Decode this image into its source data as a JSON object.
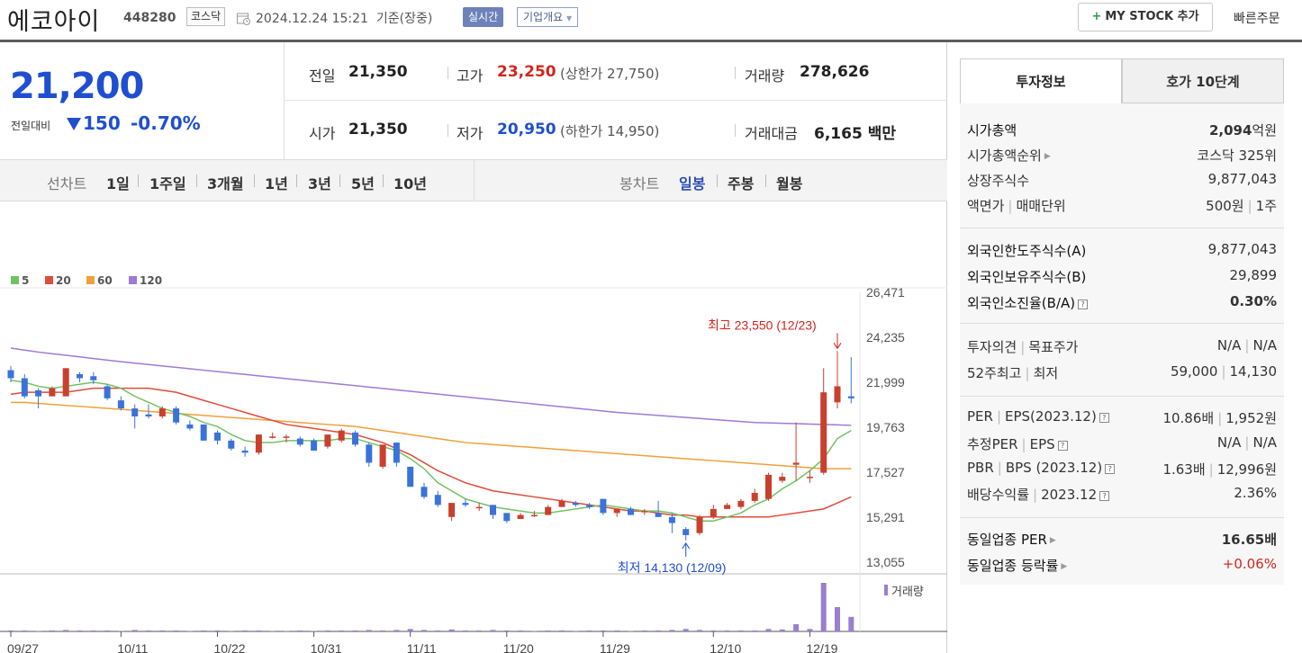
{
  "header": {
    "stock_name": "에코아이",
    "stock_code": "448280",
    "market": "코스닥",
    "datetime": "2024.12.24 15:21",
    "basis": "기준(장중)",
    "realtime_label": "실시간",
    "company_overview_label": "기업개요",
    "mystock_label": "MY STOCK 추가",
    "quick_order_label": "빠른주문"
  },
  "price": {
    "current": "21,200",
    "change_label": "전일대비",
    "change": "150",
    "change_pct": "-0.70%"
  },
  "stats": {
    "prev_close_label": "전일",
    "prev_close": "21,350",
    "high_label": "고가",
    "high": "23,250",
    "upper_limit_text": "(상한가 27,750)",
    "volume_label": "거래량",
    "volume": "278,626",
    "open_label": "시가",
    "open": "21,350",
    "low_label": "저가",
    "low": "20,950",
    "lower_limit_text": "(하한가 14,950)",
    "trade_value_label": "거래대금",
    "trade_value": "6,165",
    "trade_value_unit": "백만"
  },
  "toolbar": {
    "line_chart_label": "선차트",
    "periods": [
      "1일",
      "1주일",
      "3개월",
      "1년",
      "3년",
      "5년",
      "10년"
    ],
    "candle_chart_label": "봉차트",
    "candle_periods": [
      "일봉",
      "주봉",
      "월봉"
    ],
    "active_candle": "일봉"
  },
  "legend": [
    "5",
    "20",
    "60",
    "120"
  ],
  "colors": {
    "ma5": "#73c163",
    "ma20": "#e04c3b",
    "ma60": "#f0a03a",
    "ma120": "#a079d6",
    "up": "#c8402e",
    "down": "#3a73d8"
  },
  "annotations": {
    "high_text": "최고 23,550 (12/23)",
    "low_text": "최저 14,130 (12/09)"
  },
  "volume_label": "거래량",
  "chart_data": {
    "type": "candlestick",
    "y_ticks": [
      "26,471",
      "24,235",
      "21,999",
      "19,763",
      "17,527",
      "15,291",
      "13,055"
    ],
    "x_ticks": [
      "09/27",
      "10/11",
      "10/22",
      "10/31",
      "11/11",
      "11/20",
      "11/29",
      "12/10",
      "12/19"
    ],
    "ylim": [
      13055,
      26471
    ],
    "candles": [
      [
        22600,
        22200,
        22800,
        22000
      ],
      [
        22200,
        21300,
        22400,
        21200
      ],
      [
        21600,
        21300,
        21700,
        20700
      ],
      [
        21300,
        21700,
        21800,
        21300
      ],
      [
        21300,
        22700,
        22700,
        21300
      ],
      [
        22400,
        22200,
        22500,
        22000
      ],
      [
        22300,
        22100,
        22500,
        21900
      ],
      [
        21800,
        21200,
        21900,
        21100
      ],
      [
        21100,
        20700,
        21300,
        20600
      ],
      [
        20700,
        20300,
        20900,
        19700
      ],
      [
        20400,
        20300,
        20900,
        20200
      ],
      [
        20300,
        20700,
        20800,
        20200
      ],
      [
        20700,
        20000,
        20800,
        19900
      ],
      [
        19900,
        19700,
        20100,
        19600
      ],
      [
        19900,
        19100,
        19900,
        19100
      ],
      [
        19500,
        19100,
        19600,
        18900
      ],
      [
        19100,
        18700,
        19200,
        18600
      ],
      [
        18600,
        18500,
        18800,
        18300
      ],
      [
        18500,
        19400,
        19400,
        18400
      ],
      [
        19300,
        19300,
        19500,
        19200
      ],
      [
        19300,
        19300,
        19400,
        19000
      ],
      [
        19200,
        18900,
        19300,
        18800
      ],
      [
        19100,
        18600,
        19200,
        18600
      ],
      [
        18800,
        19400,
        19400,
        18700
      ],
      [
        19100,
        19600,
        19700,
        19000
      ],
      [
        19500,
        18900,
        19600,
        18800
      ],
      [
        18900,
        18000,
        19000,
        17800
      ],
      [
        17800,
        18900,
        18900,
        17700
      ],
      [
        19000,
        18000,
        19000,
        17800
      ],
      [
        17800,
        16800,
        17800,
        16800
      ],
      [
        16800,
        16300,
        17000,
        16200
      ],
      [
        16400,
        15900,
        16600,
        15800
      ],
      [
        15300,
        16000,
        16000,
        15100
      ],
      [
        16000,
        15900,
        16200,
        15800
      ],
      [
        15800,
        15800,
        16000,
        15600
      ],
      [
        15900,
        15400,
        15900,
        15200
      ],
      [
        15500,
        15100,
        15500,
        15000
      ],
      [
        15200,
        15400,
        15500,
        15200
      ],
      [
        15400,
        15400,
        15600,
        15300
      ],
      [
        15400,
        15800,
        15900,
        15400
      ],
      [
        15800,
        16100,
        16200,
        15800
      ],
      [
        16000,
        15900,
        16100,
        15800
      ],
      [
        15900,
        15800,
        16000,
        15700
      ],
      [
        16200,
        15500,
        16200,
        15400
      ],
      [
        15500,
        15700,
        15700,
        15300
      ],
      [
        15700,
        15400,
        15800,
        15400
      ],
      [
        15600,
        15600,
        15700,
        15400
      ],
      [
        15500,
        15300,
        16100,
        15300
      ],
      [
        15300,
        15000,
        15500,
        14500
      ],
      [
        14700,
        14400,
        14800,
        14130
      ],
      [
        14500,
        15300,
        15400,
        14400
      ],
      [
        15300,
        15700,
        15900,
        15200
      ],
      [
        15700,
        15900,
        16000,
        15700
      ],
      [
        15800,
        16100,
        16200,
        15700
      ],
      [
        16100,
        16500,
        16700,
        16000
      ],
      [
        16200,
        17400,
        17500,
        16100
      ],
      [
        17100,
        17300,
        17500,
        17000
      ],
      [
        17900,
        18000,
        20000,
        17100
      ],
      [
        17300,
        17300,
        17600,
        17000
      ],
      [
        17500,
        21500,
        22700,
        17400
      ],
      [
        21000,
        21800,
        23550,
        20700
      ],
      [
        21300,
        21200,
        23250,
        20950
      ]
    ],
    "ma5": [
      22100,
      22000,
      21800,
      21700,
      21800,
      21900,
      22000,
      21900,
      21700,
      21300,
      21000,
      20700,
      20500,
      20300,
      20000,
      19800,
      19400,
      19100,
      19000,
      19000,
      19100,
      19100,
      19100,
      19100,
      19200,
      19200,
      19000,
      18800,
      18600,
      18200,
      17700,
      17000,
      16600,
      16200,
      16000,
      15800,
      15700,
      15600,
      15500,
      15500,
      15600,
      15700,
      15800,
      15900,
      15800,
      15700,
      15600,
      15600,
      15500,
      15300,
      15100,
      15100,
      15300,
      15500,
      15900,
      16200,
      16700,
      17100,
      17600,
      18200,
      19200,
      19600
    ],
    "ma20": [
      21400,
      21500,
      21500,
      21500,
      21500,
      21600,
      21700,
      21700,
      21700,
      21700,
      21700,
      21600,
      21500,
      21300,
      21100,
      20900,
      20700,
      20500,
      20300,
      20100,
      19900,
      19800,
      19700,
      19600,
      19500,
      19400,
      19200,
      19000,
      18700,
      18400,
      18000,
      17600,
      17300,
      17000,
      16800,
      16600,
      16500,
      16400,
      16300,
      16200,
      16100,
      16000,
      15900,
      15800,
      15700,
      15600,
      15600,
      15500,
      15400,
      15400,
      15300,
      15300,
      15300,
      15300,
      15300,
      15300,
      15400,
      15500,
      15600,
      15700,
      16000,
      16300
    ],
    "ma60": [
      21000,
      21000,
      20950,
      20900,
      20850,
      20800,
      20750,
      20700,
      20650,
      20600,
      20550,
      20500,
      20450,
      20400,
      20350,
      20300,
      20250,
      20200,
      20150,
      20100,
      20050,
      20000,
      19950,
      19900,
      19850,
      19800,
      19700,
      19600,
      19500,
      19400,
      19300,
      19200,
      19100,
      19000,
      18950,
      18900,
      18850,
      18800,
      18750,
      18700,
      18650,
      18600,
      18550,
      18500,
      18450,
      18400,
      18350,
      18300,
      18250,
      18200,
      18150,
      18100,
      18050,
      18000,
      17950,
      17900,
      17850,
      17800,
      17750,
      17700,
      17700,
      17700
    ],
    "ma120": [
      23700,
      23600,
      23500,
      23420,
      23340,
      23260,
      23180,
      23100,
      23020,
      22950,
      22880,
      22810,
      22740,
      22670,
      22600,
      22530,
      22460,
      22390,
      22320,
      22250,
      22180,
      22110,
      22040,
      21970,
      21900,
      21830,
      21760,
      21690,
      21620,
      21550,
      21480,
      21410,
      21340,
      21270,
      21200,
      21130,
      21060,
      20990,
      20920,
      20850,
      20780,
      20710,
      20640,
      20570,
      20500,
      20450,
      20400,
      20350,
      20300,
      20250,
      20200,
      20150,
      20100,
      20050,
      20000,
      19980,
      19960,
      19940,
      19920,
      19900,
      19880,
      19860
    ],
    "volume_rel": [
      0.02,
      0.02,
      0.01,
      0.02,
      0.03,
      0.02,
      0.02,
      0.02,
      0.01,
      0.03,
      0.02,
      0.02,
      0.02,
      0.01,
      0.02,
      0.02,
      0.01,
      0.02,
      0.02,
      0.01,
      0.01,
      0.02,
      0.01,
      0.02,
      0.02,
      0.02,
      0.03,
      0.02,
      0.03,
      0.05,
      0.03,
      0.02,
      0.04,
      0.02,
      0.02,
      0.03,
      0.02,
      0.02,
      0.01,
      0.02,
      0.02,
      0.01,
      0.02,
      0.02,
      0.02,
      0.01,
      0.02,
      0.02,
      0.03,
      0.05,
      0.03,
      0.02,
      0.02,
      0.02,
      0.02,
      0.05,
      0.04,
      0.15,
      0.05,
      1.0,
      0.5,
      0.3
    ]
  },
  "right_panel": {
    "tab_active": "투자정보",
    "tab_inactive": "호가 10단계",
    "rows1": [
      {
        "k": "시가총액",
        "v": "2,094",
        "unit": "억원"
      },
      {
        "k": "시가총액순위",
        "v": "코스닥 325위"
      },
      {
        "k": "상장주식수",
        "v": "9,877,043"
      },
      {
        "k": "액면가",
        "k2": "매매단위",
        "v": "500원",
        "v2": "1주"
      }
    ],
    "rows2": [
      {
        "k": "외국인한도주식수(A)",
        "v": "9,877,043"
      },
      {
        "k": "외국인보유주식수(B)",
        "v": "29,899"
      },
      {
        "k": "외국인소진율(B/A)",
        "v": "0.30%"
      }
    ],
    "rows3": [
      {
        "k": "투자의견",
        "k2": "목표주가",
        "v": "N/A",
        "v2": "N/A"
      },
      {
        "k": "52주최고",
        "k2": "최저",
        "v": "59,000",
        "v2": "14,130"
      }
    ],
    "rows4": [
      {
        "k": "PER",
        "k2": "EPS(2023.12)",
        "v": "10.86배",
        "v2": "1,952원"
      },
      {
        "k": "추정PER",
        "k2": "EPS",
        "v": "N/A",
        "v2": "N/A"
      },
      {
        "k": "PBR",
        "k2": "BPS (2023.12)",
        "v": "1.63배",
        "v2": "12,996원"
      },
      {
        "k": "배당수익률",
        "k2": "2023.12",
        "v": "2.36%"
      }
    ],
    "rows5": [
      {
        "k": "동일업종 PER",
        "v": "16.65배"
      },
      {
        "k": "동일업종 등락률",
        "v": "+0.06%"
      }
    ]
  }
}
